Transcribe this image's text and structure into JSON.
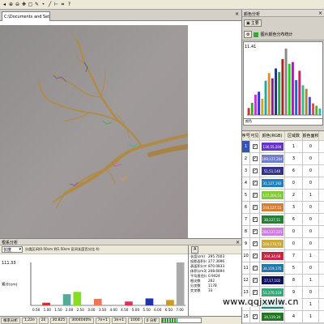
{
  "toolbar_icons": [
    "back-icon",
    "zoom-in-icon",
    "zoom-out-icon",
    "pan-icon",
    "select-icon",
    "draw-icon",
    "point-icon",
    "line-icon",
    "measure-icon",
    "crop-icon",
    "help-icon"
  ],
  "document": {
    "tab_title": "C:\\Documents and Setti..."
  },
  "right_panel": {
    "title": "颜色分析",
    "tab_label": "主要",
    "sub_label": "图片颜色分布统计",
    "hist_max": "11.41",
    "hist_foot": "颜色",
    "hist_bars": [
      {
        "v": 1.2,
        "c": "#cc3333"
      },
      {
        "v": 2.1,
        "c": "#33aa33"
      },
      {
        "v": 3.5,
        "c": "#cc33cc"
      },
      {
        "v": 4.0,
        "c": "#3333cc"
      },
      {
        "v": 2.8,
        "c": "#ccaa22"
      },
      {
        "v": 5.9,
        "c": "#22aaaa"
      },
      {
        "v": 7.2,
        "c": "#ee8822"
      },
      {
        "v": 6.3,
        "c": "#882288"
      },
      {
        "v": 8.0,
        "c": "#1133aa"
      },
      {
        "v": 7.4,
        "c": "#22aa55"
      },
      {
        "v": 9.6,
        "c": "#aa2222"
      },
      {
        "v": 11.41,
        "c": "#888888"
      },
      {
        "v": 8.8,
        "c": "#22cc22"
      },
      {
        "v": 9.1,
        "c": "#aa22aa"
      },
      {
        "v": 6.0,
        "c": "#2266cc"
      },
      {
        "v": 7.6,
        "c": "#cc2266"
      },
      {
        "v": 5.1,
        "c": "#33bb88"
      },
      {
        "v": 4.5,
        "c": "#aa8833"
      },
      {
        "v": 3.1,
        "c": "#4444ee"
      },
      {
        "v": 2.0,
        "c": "#ee4444"
      },
      {
        "v": 1.6,
        "c": "#66aa22"
      },
      {
        "v": 1.1,
        "c": "#22bbbb"
      }
    ],
    "table_headers": [
      "序号",
      "可见",
      "颜色(RGB)",
      "区域数",
      "颜色面积"
    ],
    "rows": [
      {
        "n": "1",
        "color": "#6633cc",
        "rgb": "136,55,204",
        "a": "1",
        "b": "0",
        "sel": true
      },
      {
        "n": "2",
        "color": "#6d7fcc",
        "rgb": "109,127,204",
        "a": "3",
        "b": "0"
      },
      {
        "n": "3",
        "color": "#33338c",
        "rgb": "51,51,140",
        "a": "6",
        "b": "0"
      },
      {
        "n": "4",
        "color": "#1f7fc0",
        "rgb": "31,127,192",
        "a": "0",
        "b": "0"
      },
      {
        "n": "5",
        "color": "#7fcc33",
        "rgb": "127,204,51",
        "a": "2",
        "b": "1"
      },
      {
        "n": "6",
        "color": "#d67f33",
        "rgb": "214,127,51",
        "a": "3",
        "b": "0"
      },
      {
        "n": "7",
        "color": "#267f33",
        "rgb": "38,127,51",
        "a": "6",
        "b": "0"
      },
      {
        "n": "8",
        "color": "#cc7fdd",
        "rgb": "204,127,221",
        "a": "0",
        "b": "0"
      },
      {
        "n": "9",
        "color": "#ccaa33",
        "rgb": "204,170,51",
        "a": "0",
        "b": "0"
      },
      {
        "n": "10",
        "color": "#cc2244",
        "rgb": "204,34,68",
        "a": "7",
        "b": "1"
      },
      {
        "n": "11",
        "color": "#2277aa",
        "rgb": "34,119,170",
        "a": "5",
        "b": "0"
      },
      {
        "n": "12",
        "color": "#111166",
        "rgb": "17,17,102",
        "a": "8",
        "b": "1"
      },
      {
        "n": "13",
        "color": "#33aa77",
        "rgb": "51,170,119",
        "a": "9",
        "b": "0"
      },
      {
        "n": "14",
        "color": "#118877",
        "rgb": "17,136,119",
        "a": "0",
        "b": "1"
      },
      {
        "n": "15",
        "color": "#227722",
        "rgb": "34,119,34",
        "a": "4",
        "b": "1"
      }
    ]
  },
  "bottom": {
    "title": "根系分析",
    "select_value": "长度",
    "filter_text": "分类区间(0.50cm 到1.50cm 区间长度百分比 4)",
    "stats_tools": [
      "A",
      ""
    ],
    "stats": [
      [
        "长度(cm)",
        "295.7003"
      ],
      [
        "投影面积(cm2)",
        "277.3096"
      ],
      [
        "表面积(cm2)",
        "870.0833"
      ],
      [
        "体积(cm3)",
        "208.6694"
      ],
      [
        "平均直径(cm)",
        "0.9424"
      ],
      [
        "根尖数",
        "262"
      ],
      [
        "分叉数",
        "1178"
      ],
      [
        "交叉数",
        "33"
      ]
    ]
  },
  "chart_data": {
    "type": "bar",
    "categories": [
      "0.50",
      "1.00",
      "1.50",
      "2.00",
      "2.50",
      "3.00",
      "3.50",
      "4.00",
      "4.50",
      "5.00",
      "5.50",
      "6.00",
      "6.50",
      "7.00"
    ],
    "values": [
      0,
      7,
      0,
      29,
      35,
      0,
      17,
      0,
      0,
      10,
      0,
      18,
      0,
      14,
      0,
      111.33
    ],
    "values_by_category": [
      0,
      7,
      0,
      29,
      35,
      0,
      17,
      0,
      0,
      10,
      0,
      18,
      0,
      14,
      111.33
    ],
    "colors": [
      "#aaaaaa",
      "#cc3333",
      "#aaaaaa",
      "#55aa99",
      "#88dd22",
      "#aaaaaa",
      "#ee7755",
      "#aaaaaa",
      "#aaaaaa",
      "#dd3355",
      "#aaaaaa",
      "#2233aa",
      "#aaaaaa",
      "#cc9922",
      "#aaaaaa"
    ],
    "ymax_label": "111.33",
    "ylabel": "累计(cm)",
    "ylim": [
      0,
      111.33
    ],
    "grid": false
  },
  "status": {
    "label": "根系分析",
    "fields": [
      "1,22e",
      "2E",
      "30.825",
      "3004040%",
      "7e+1",
      "3e+1",
      "1000",
      "0 分析"
    ],
    "progress": 0.4
  },
  "watermark": "www.qqjxwlw.cn"
}
